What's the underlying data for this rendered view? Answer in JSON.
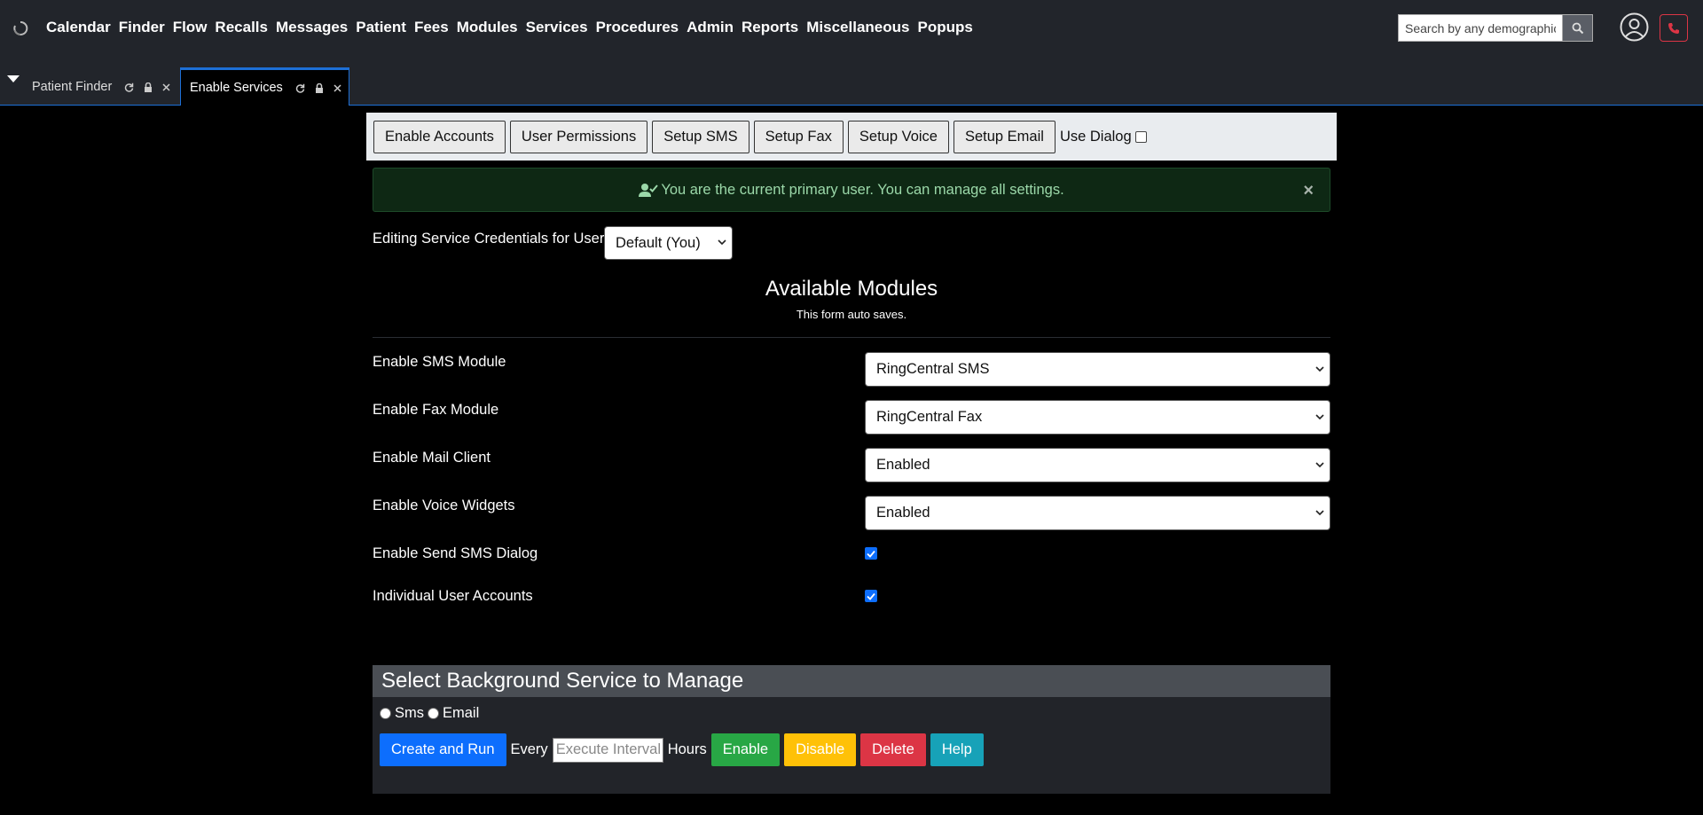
{
  "nav": {
    "logo_icon": "openemr-logo-icon",
    "menu": [
      "Calendar",
      "Finder",
      "Flow",
      "Recalls",
      "Messages",
      "Patient",
      "Fees",
      "Modules",
      "Services",
      "Procedures",
      "Admin",
      "Reports",
      "Miscellaneous",
      "Popups"
    ],
    "search_placeholder": "Search by any demographics",
    "search_icon": "search-icon",
    "user_icon": "user-circle-icon",
    "phone_icon": "phone-icon",
    "phone_color": "#dc3545"
  },
  "tabs": [
    {
      "label": "Patient Finder",
      "active": false
    },
    {
      "label": "Enable Services",
      "active": true
    }
  ],
  "toolbar": {
    "buttons": [
      "Enable Accounts",
      "User Permissions",
      "Setup SMS",
      "Setup Fax",
      "Setup Voice",
      "Setup Email"
    ],
    "use_dialog_label": "Use Dialog"
  },
  "alert": {
    "text": "You are the current primary user. You can manage all settings.",
    "close_label": "×"
  },
  "editing": {
    "label": "Editing Service Credentials for User",
    "selected": "Default (You)"
  },
  "modules": {
    "title": "Available Modules",
    "subtitle": "This form auto saves.",
    "rows": [
      {
        "label": "Enable SMS Module",
        "value": "RingCentral SMS"
      },
      {
        "label": "Enable Fax Module",
        "value": "RingCentral Fax"
      },
      {
        "label": "Enable Mail Client",
        "value": "Enabled"
      },
      {
        "label": "Enable Voice Widgets",
        "value": "Enabled"
      }
    ],
    "checks": [
      {
        "label": "Enable Send SMS Dialog",
        "checked": true
      },
      {
        "label": "Individual User Accounts",
        "checked": true
      }
    ]
  },
  "service": {
    "title": "Select Background Service to Manage",
    "radio_sms": "Sms",
    "radio_email": "Email",
    "create_label": "Create and Run",
    "every_label": "Every",
    "interval_placeholder": "Execute Interval",
    "hours_label": "Hours",
    "enable_label": "Enable",
    "disable_label": "Disable",
    "delete_label": "Delete",
    "help_label": "Help",
    "colors": {
      "create": "#0d6efd",
      "enable": "#28a745",
      "disable": "#ffc107",
      "delete": "#dc3545",
      "help": "#17a2b8"
    }
  }
}
